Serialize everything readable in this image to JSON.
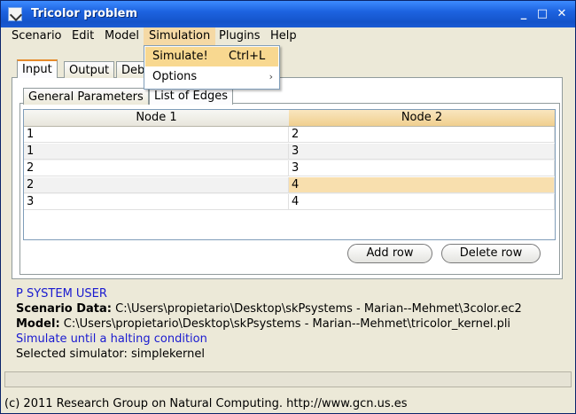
{
  "window": {
    "title": "Tricolor problem"
  },
  "menubar": [
    "Scenario",
    "Edit",
    "Model",
    "Simulation",
    "Plugins",
    "Help"
  ],
  "dropdown": {
    "items": [
      {
        "label": "Simulate!",
        "shortcut": "Ctrl+L"
      },
      {
        "label": "Options",
        "arrow": "›"
      }
    ]
  },
  "tabs": [
    "Input",
    "Output",
    "Deb"
  ],
  "subtabs": [
    "General Parameters",
    "List of Edges"
  ],
  "table": {
    "headers": [
      "Node 1",
      "Node 2"
    ],
    "rows": [
      [
        "1",
        "2"
      ],
      [
        "1",
        "3"
      ],
      [
        "2",
        "3"
      ],
      [
        "2",
        "4"
      ],
      [
        "3",
        "4"
      ]
    ]
  },
  "buttons": {
    "add_row": "Add row",
    "delete_row": "Delete row"
  },
  "info": {
    "line1": "P SYSTEM USER",
    "scenario_label": "Scenario Data:",
    "scenario_path": "C:\\Users\\propietario\\Desktop\\skPsystems - Marian--Mehmet\\3color.ec2",
    "model_label": "Model:",
    "model_path": "C:\\Users\\propietario\\Desktop\\skPsystems - Marian--Mehmet\\tricolor_kernel.pli",
    "simulate_line": "Simulate until a halting condition",
    "simulator_line": "Selected simulator: simplekernel"
  },
  "status": "(c) 2011 Research Group on Natural Computing. http://www.gcn.us.es"
}
